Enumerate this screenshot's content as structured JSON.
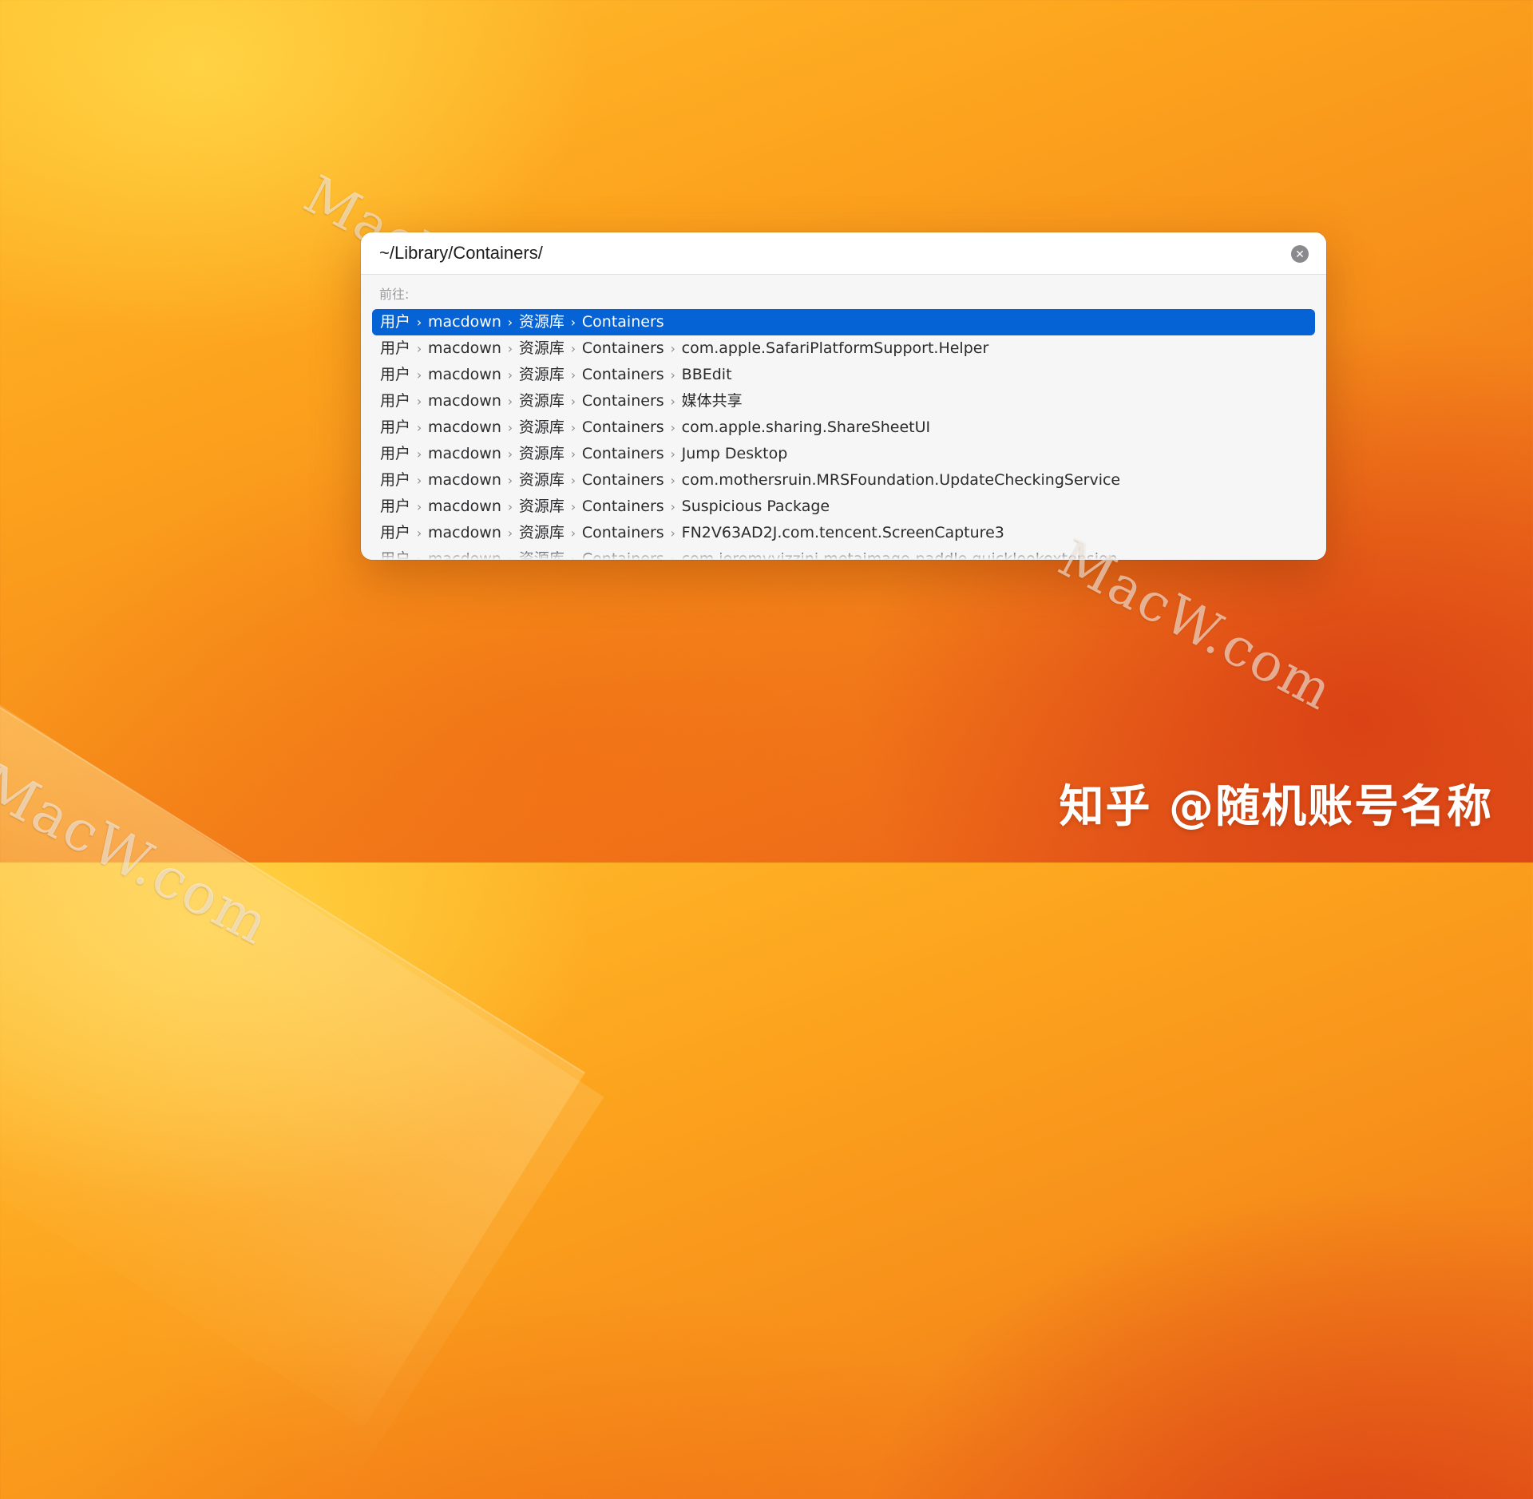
{
  "dialog": {
    "path_value": "~/Library/Containers/",
    "clear_icon": "close-circle-icon",
    "goto_label": "前往:",
    "rows": [
      {
        "segments": [
          "用户",
          "macdown",
          "资源库",
          "Containers"
        ],
        "selected": true
      },
      {
        "segments": [
          "用户",
          "macdown",
          "资源库",
          "Containers",
          "com.apple.SafariPlatformSupport.Helper"
        ],
        "selected": false
      },
      {
        "segments": [
          "用户",
          "macdown",
          "资源库",
          "Containers",
          "BBEdit"
        ],
        "selected": false
      },
      {
        "segments": [
          "用户",
          "macdown",
          "资源库",
          "Containers",
          "媒体共享"
        ],
        "selected": false
      },
      {
        "segments": [
          "用户",
          "macdown",
          "资源库",
          "Containers",
          "com.apple.sharing.ShareSheetUI"
        ],
        "selected": false
      },
      {
        "segments": [
          "用户",
          "macdown",
          "资源库",
          "Containers",
          "Jump Desktop"
        ],
        "selected": false
      },
      {
        "segments": [
          "用户",
          "macdown",
          "资源库",
          "Containers",
          "com.mothersruin.MRSFoundation.UpdateCheckingService"
        ],
        "selected": false
      },
      {
        "segments": [
          "用户",
          "macdown",
          "资源库",
          "Containers",
          "Suspicious Package"
        ],
        "selected": false
      },
      {
        "segments": [
          "用户",
          "macdown",
          "资源库",
          "Containers",
          "FN2V63AD2J.com.tencent.ScreenCapture3"
        ],
        "selected": false
      },
      {
        "segments": [
          "用户",
          "macdown",
          "资源库",
          "Containers",
          "com.jeremyvizzini.metaimage-paddle.quicklookextension"
        ],
        "selected": false
      }
    ]
  },
  "watermarks": [
    "MacW.com",
    "MacW.com",
    "MacW.com"
  ],
  "credit": "知乎 @随机账号名称",
  "colors": {
    "selection": "#0663d6",
    "wallpaper_light": "#ffbf2e",
    "wallpaper_dark": "#e3521a"
  }
}
